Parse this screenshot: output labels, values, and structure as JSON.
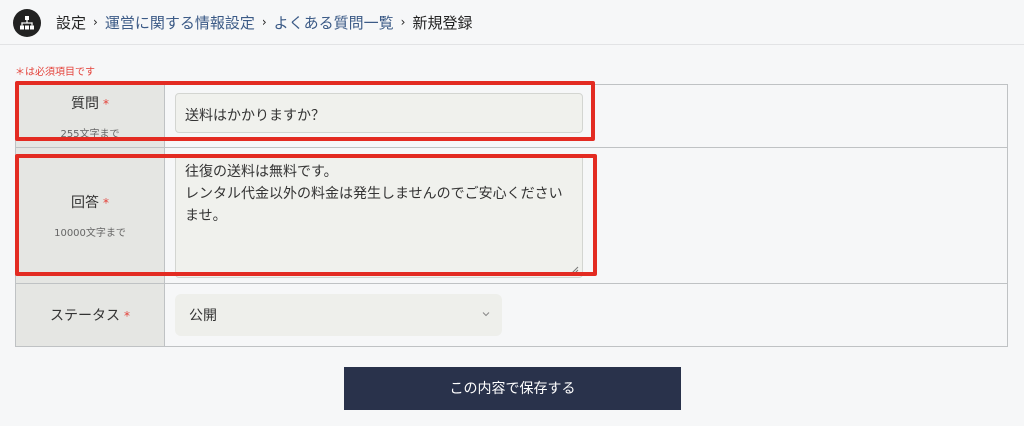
{
  "breadcrumb": {
    "root": "設定",
    "level1": "運営に関する情報設定",
    "level2": "よくある質問一覧",
    "current": "新規登録",
    "separator": "›"
  },
  "form": {
    "required_note": "＊は必須項目です",
    "required_mark": "*",
    "question": {
      "label": "質問",
      "limit": "255文字まで",
      "value": "送料はかかりますか？"
    },
    "answer": {
      "label": "回答",
      "limit": "10000文字まで",
      "value": "往復の送料は無料です。\nレンタル代金以外の料金は発生しませんのでご安心ください\nませ。"
    },
    "status": {
      "label": "ステータス",
      "selected": "公開"
    }
  },
  "actions": {
    "save_label": "この内容で保存する"
  },
  "colors": {
    "accent_required": "#e4423a",
    "highlight": "#e32b22",
    "button_bg": "#29324b",
    "link": "#3b5a86"
  },
  "icons": {
    "nav": "sitemap-icon",
    "select": "chevron-down-icon",
    "resize": "resize-handle-icon"
  }
}
